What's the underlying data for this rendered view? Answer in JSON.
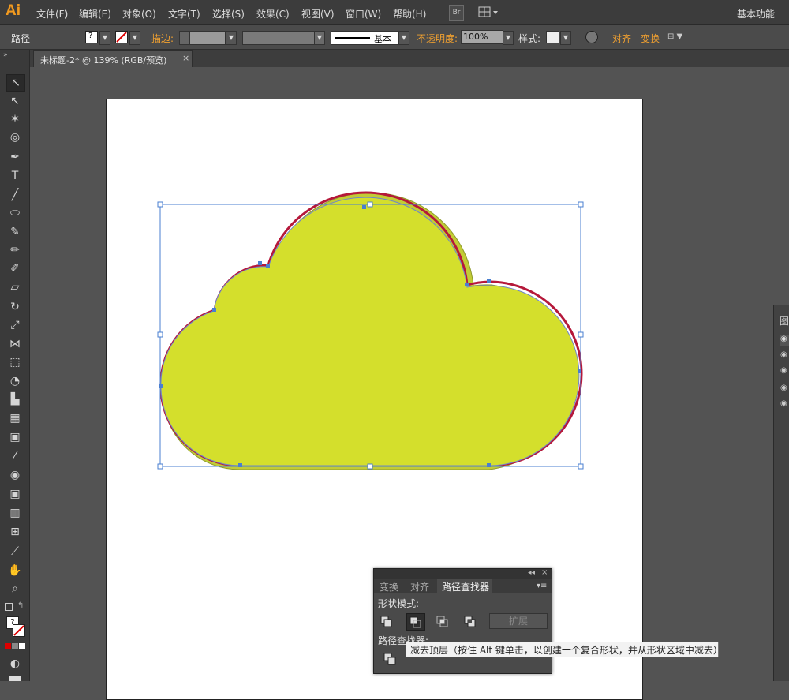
{
  "app": {
    "logo": "Ai"
  },
  "menu": {
    "items": [
      "文件(F)",
      "编辑(E)",
      "对象(O)",
      "文字(T)",
      "选择(S)",
      "效果(C)",
      "视图(V)",
      "窗口(W)",
      "帮助(H)"
    ],
    "bridge": "Br",
    "workspace": "基本功能"
  },
  "control": {
    "path_label": "路径",
    "stroke_label": "描边:",
    "brush_label": "基本",
    "opacity_label": "不透明度:",
    "opacity_value": "100%",
    "style_label": "样式:",
    "align_label": "对齐",
    "transform_label": "变换",
    "colors": {
      "accent": "#f0a030"
    }
  },
  "document": {
    "tab_title": "未标题-2* @ 139% (RGB/预览)"
  },
  "artwork": {
    "fill": "#d4df2c",
    "stroke": "#b5183a",
    "selection": "#4a7fd0"
  },
  "pathfinder": {
    "tabs": [
      "变换",
      "对齐",
      "路径查找器"
    ],
    "shape_modes_label": "形状模式:",
    "expand_label": "扩展",
    "pathfinders_label": "路径查找器:",
    "tooltip": "减去顶层（按住 Alt 键单击，以创建一个复合形状，并从形状区域中减去）"
  },
  "right_panel": {
    "label": "图"
  }
}
